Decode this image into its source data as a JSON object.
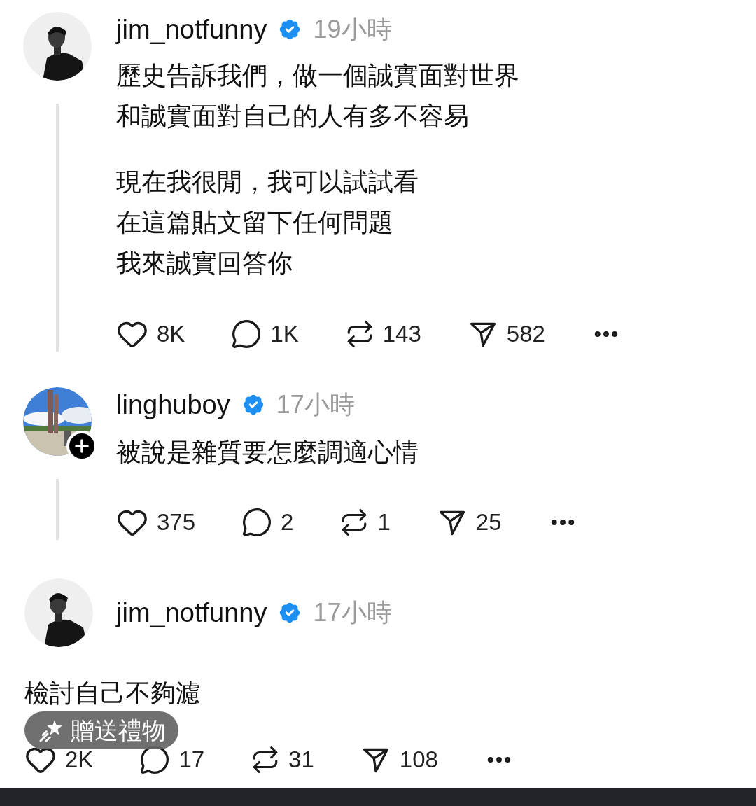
{
  "posts": [
    {
      "kind": "indented",
      "username": "jim_notfunny",
      "verified": true,
      "time": "19小時",
      "follow_badge": false,
      "avatar": {
        "kind": "picture"
      },
      "paragraphs": [
        [
          "歷史告訴我們，做一個誠實面對世界",
          "和誠實面對自己的人有多不容易"
        ],
        [
          "現在我很閒，我可以試試看",
          "在這篇貼文留下任何問題",
          "我來誠實回答你"
        ]
      ],
      "stats": {
        "likes": "8K",
        "replies": "1K",
        "reposts": "143",
        "shares": "582"
      }
    },
    {
      "kind": "indented",
      "username": "linghuboy",
      "verified": true,
      "time": "17小時",
      "follow_badge": true,
      "avatar": {
        "kind": "picture"
      },
      "paragraphs": [
        [
          "被說是雜質要怎麼調適心情"
        ]
      ],
      "stats": {
        "likes": "375",
        "replies": "2",
        "reposts": "1",
        "shares": "25"
      }
    },
    {
      "kind": "full",
      "username": "jim_notfunny",
      "verified": true,
      "time": "17小時",
      "follow_badge": false,
      "avatar": {
        "kind": "picture"
      },
      "paragraphs": [
        [
          "檢討自己不夠濾"
        ]
      ],
      "stats": {
        "likes": "2K",
        "replies": "17",
        "reposts": "31",
        "shares": "108"
      }
    }
  ],
  "gift_button": {
    "label": "贈送禮物"
  }
}
